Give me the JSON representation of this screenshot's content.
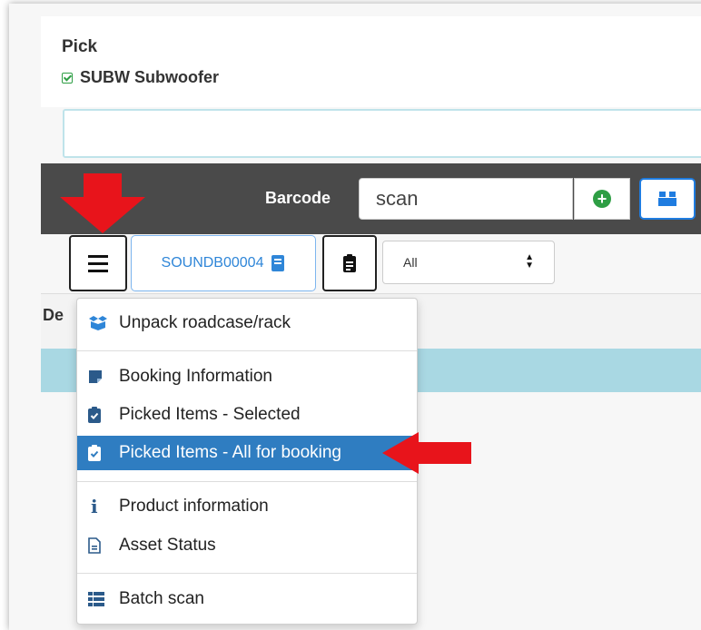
{
  "pick": {
    "title": "Pick",
    "product": "SUBW Subwoofer"
  },
  "toolbar": {
    "barcode_label": "Barcode",
    "barcode_value": "scan"
  },
  "controls": {
    "booking_code": "SOUNDB00004",
    "filter_value": "All"
  },
  "table": {
    "header_partial": "De"
  },
  "menu": {
    "items": [
      {
        "label": "Unpack roadcase/rack",
        "icon": "box-open-icon"
      },
      {
        "label": "Booking Information",
        "icon": "sticky-note-icon"
      },
      {
        "label": "Picked Items - Selected",
        "icon": "clipboard-check-icon"
      },
      {
        "label": "Picked Items - All for booking",
        "icon": "clipboard-check-icon",
        "active": true
      },
      {
        "label": "Product information",
        "icon": "info-icon"
      },
      {
        "label": "Asset Status",
        "icon": "file-icon"
      },
      {
        "label": "Batch scan",
        "icon": "list-icon"
      }
    ]
  },
  "colors": {
    "toolbar_bg": "#4a4a4a",
    "accent_blue": "#2f7dc1",
    "selected_row": "#a9d8e3",
    "annotation_red": "#e8141b",
    "success_green": "#2e9e44"
  }
}
